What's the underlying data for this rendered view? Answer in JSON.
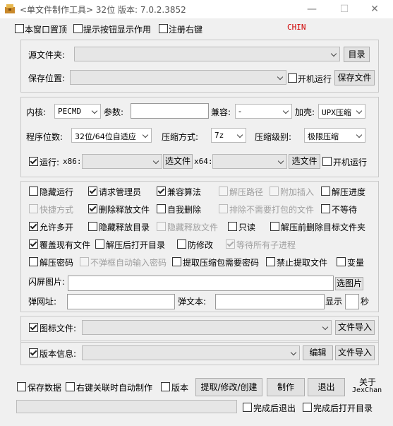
{
  "window": {
    "title": "<单文件制作工具> 32位  版本: 7.0.2.3852",
    "minimize_glyph": "—",
    "maximize_glyph": "☐",
    "close_glyph": "✕"
  },
  "top_options": {
    "stay_on_top": "本窗口置顶",
    "show_tooltips": "提示按钮显示作用",
    "register_right_key": "注册右键",
    "lang_badge": "CHIN"
  },
  "source": {
    "src_label": "源文件夹:",
    "dir_button": "目录",
    "save_label": "保存位置:",
    "startup_run": "开机运行",
    "save_file_button": "保存文件"
  },
  "kernel": {
    "kernel_label": "内核:",
    "kernel_value": "PECMD",
    "params_label": "参数:",
    "compat_label": "兼容:",
    "compat_value": "-",
    "shell_label": "加壳:",
    "shell_value": "UPX压缩",
    "bits_label": "程序位数:",
    "bits_value": "32位/64位自适应",
    "compress_label": "压缩方式:",
    "compress_value": "7z",
    "level_label": "压缩级别:",
    "level_value": "极限压缩",
    "run_label": "运行:",
    "x86_label": "x86:",
    "x86_button": "选文件",
    "x64_label": "x64:",
    "x64_button": "选文件",
    "startup_run": "开机运行"
  },
  "options": {
    "r1": [
      "隐藏运行",
      "请求管理员",
      "兼容算法",
      "解压路径",
      "附加插入",
      "解压进度"
    ],
    "r2": [
      "快捷方式",
      "删除释放文件",
      "自我删除",
      "排除不需要打包的文件",
      "不等待"
    ],
    "r3": [
      "允许多开",
      "隐藏释放目录",
      "隐藏释放文件",
      "只读",
      "解压前删除目标文件夹"
    ],
    "r4": [
      "覆盖现有文件",
      "解压后打开目录",
      "防修改",
      "等待所有子进程"
    ],
    "r5": [
      "解压密码",
      "不弹框自动输入密码",
      "提取压缩包需要密码",
      "禁止提取文件",
      "变量"
    ],
    "splash_label": "闪屏图片:",
    "splash_button": "选图片",
    "popup_url_label": "弹网址:",
    "popup_text_label": "弹文本:",
    "show_label": "显示",
    "seconds_label": "秒"
  },
  "icon": {
    "icon_file_label": "图标文件:",
    "icon_import": "文件导入",
    "version_label": "版本信息:",
    "edit_button": "编辑",
    "version_import": "文件导入"
  },
  "bottom": {
    "save_data": "保存数据",
    "right_key_auto": "右键关联时自动制作",
    "version": "版本",
    "extract_button": "提取/修改/创建",
    "make_button": "制作",
    "exit_button": "退出",
    "about_line1": "关于",
    "about_line2": "JexChan",
    "exit_after": "完成后退出",
    "open_after": "完成后打开目录"
  }
}
